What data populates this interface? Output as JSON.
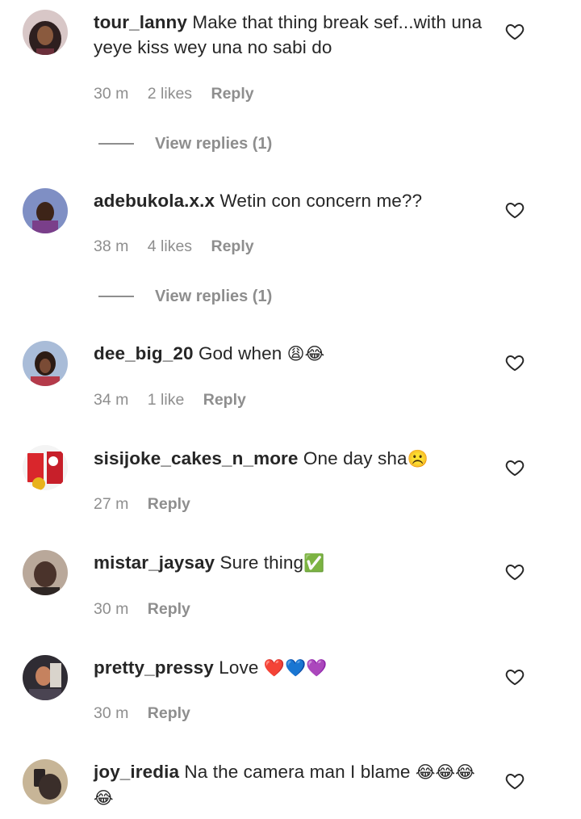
{
  "comments": [
    {
      "username": "tour_lanny",
      "text": "Make that thing break sef...with una yeye kiss wey una no sabi do",
      "time": "30 m",
      "likes": "2 likes",
      "reply": "Reply",
      "view_replies": "View replies (1)",
      "avatar_colors": [
        "#3b2a2a",
        "#c98a5e"
      ]
    },
    {
      "username": "adebukola.x.x",
      "text": "Wetin con concern me??",
      "time": "38 m",
      "likes": "4 likes",
      "reply": "Reply",
      "view_replies": "View replies (1)",
      "avatar_colors": [
        "#5a6fa8",
        "#6b3f7a"
      ]
    },
    {
      "username": "dee_big_20",
      "text": "God when ",
      "emoji": "😩😂",
      "time": "34 m",
      "likes": "1 like",
      "reply": "Reply",
      "avatar_colors": [
        "#8aa3c9",
        "#6a4a3a"
      ]
    },
    {
      "username": "sisijoke_cakes_n_more",
      "text": "One day sha",
      "emoji": "☹️",
      "time": "27 m",
      "reply": "Reply",
      "avatar_colors": [
        "#d9262c",
        "#f2f2f2"
      ]
    },
    {
      "username": "mistar_jaysay",
      "text": "Sure thing",
      "emoji": "✅",
      "time": "30 m",
      "reply": "Reply",
      "avatar_colors": [
        "#4a3b34",
        "#c9b8a8"
      ]
    },
    {
      "username": "pretty_pressy",
      "text": "Love ",
      "emoji": "❤️💙💜",
      "time": "30 m",
      "reply": "Reply",
      "avatar_colors": [
        "#2b2a30",
        "#c5825f"
      ]
    },
    {
      "username": "joy_iredia",
      "text": "Na the camera man I blame ",
      "emoji": "😂😂😂😂",
      "avatar_colors": [
        "#b9a484",
        "#3a3030"
      ]
    }
  ]
}
